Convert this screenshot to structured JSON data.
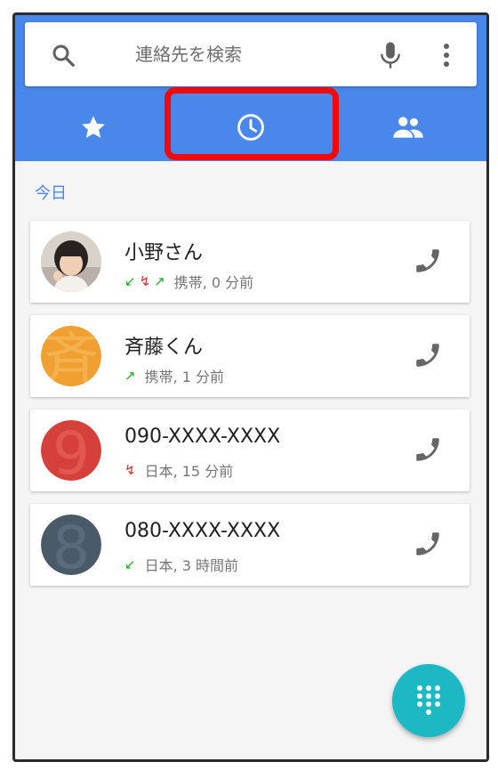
{
  "search": {
    "placeholder": "連絡先を検索"
  },
  "tabs": [
    {
      "name": "favorites",
      "icon": "star-icon"
    },
    {
      "name": "recent",
      "icon": "clock-icon",
      "selected": true
    },
    {
      "name": "contacts",
      "icon": "people-icon"
    }
  ],
  "section": {
    "label": "今日"
  },
  "calls": [
    {
      "name": "小野さん",
      "meta": "携帯, 0 分前",
      "arrows": [
        "missed-in-green",
        "missed-red",
        "outgoing-green"
      ],
      "avatar": "photo"
    },
    {
      "name": "斉藤くん",
      "meta": "携帯, 1 分前",
      "arrows": [
        "outgoing-green"
      ],
      "avatar_color": "#f0a030",
      "avatar_letter": "斉"
    },
    {
      "name": "090-XXXX-XXXX",
      "meta": "日本, 15 分前",
      "arrows": [
        "missed-red"
      ],
      "avatar_color": "#d6403a",
      "avatar_letter": "9"
    },
    {
      "name": "080-XXXX-XXXX",
      "meta": "日本, 3 時間前",
      "arrows": [
        "incoming-green"
      ],
      "avatar_color": "#4a5a69",
      "avatar_letter": "8"
    }
  ],
  "colors": {
    "appbar": "#4a87ea",
    "highlight": "#f20a0a",
    "fab": "#1cb8c4",
    "accent": "#4a87ea"
  }
}
